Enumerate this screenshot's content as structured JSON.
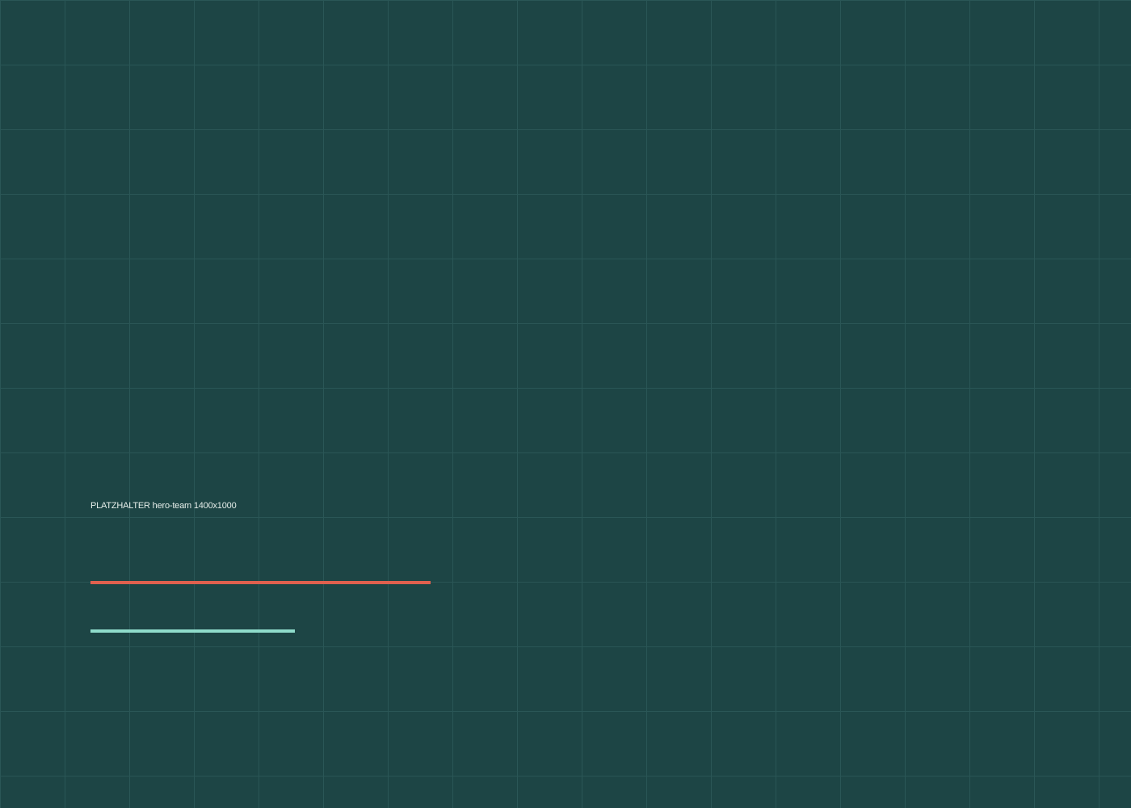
{
  "placeholder": {
    "label": "PLATZHALTER hero-team 1400x1000"
  },
  "colors": {
    "background": "#1d4545",
    "grid_line": "#2a5656",
    "label_text": "#e6eeea",
    "accent_bar": "#e0604e",
    "secondary_bar": "#8fdccb"
  }
}
